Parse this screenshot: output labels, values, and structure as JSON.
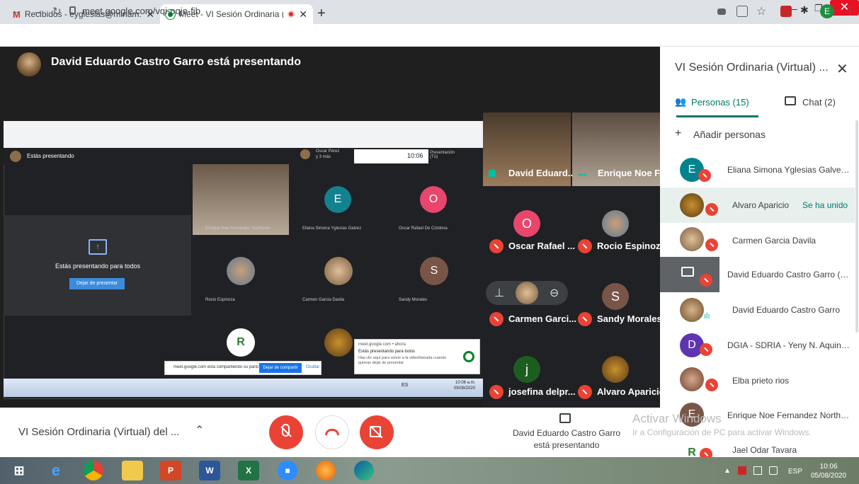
{
  "browser": {
    "tabs": [
      {
        "title": "Recibidos - eyglesias@minam.go",
        "icon": "gmail-icon"
      },
      {
        "title": "Meet - VI Sesión Ordinaria (\\",
        "icon": "meet-icon"
      }
    ],
    "url": "meet.google.com/vqi-pqjo-fib"
  },
  "stage": {
    "presenting_title": "David Eduardo Castro Garro está presentando",
    "shared": {
      "top_label": "Estás presentando",
      "clock": "10:06",
      "presenting_for_all": "Estás presentando para todos",
      "stop_button": "Dejar de presentar",
      "caller_line1": "Oscar Pérez",
      "caller_line2": "y 3 más",
      "present_label": "Presentación (Tú)",
      "share_notice": "meet.google.com está compartiendo su pantalla.",
      "share_stop": "Dejar de compartir",
      "share_hide": "Ocultar",
      "popup_site": "meet.google.com • ahora",
      "popup_title": "Estás presentando para todos",
      "popup_body": "Has clic aquí para volver a la videollamada cuando quieras dejar de presentar",
      "tiles": [
        {
          "name": "Enrique Noe Fernandez Northcote"
        },
        {
          "name": "Eliana Simona Yglesias Galvez",
          "initial": "E"
        },
        {
          "name": "Oscar Rafael De Córdova",
          "initial": "O"
        },
        {
          "name": "Rocio Espinoza"
        },
        {
          "name": "Carmen Garcia Davila"
        },
        {
          "name": "Sandy Morales",
          "initial": "S"
        }
      ],
      "inner_clock_time": "10:06 a.m.",
      "inner_clock_date": "05/08/2020",
      "inner_lang": "ES"
    },
    "tiles": [
      {
        "name": "David Eduard..."
      },
      {
        "name": "Enrique Noe F..."
      },
      {
        "name": "Oscar Rafael ...",
        "initial": "O"
      },
      {
        "name": "Rocio Espinoza"
      },
      {
        "name": "Carmen Garci..."
      },
      {
        "name": "Sandy Morales",
        "initial": "S"
      },
      {
        "name": "josefina delpr...",
        "initial": "j"
      },
      {
        "name": "Alvaro Aparicio"
      }
    ]
  },
  "panel": {
    "title": "VI Sesión Ordinaria (Virtual) ...",
    "tab_people": "Personas (15)",
    "tab_chat": "Chat (2)",
    "add_people": "Añadir personas",
    "people": [
      {
        "name": "Eliana Simona Yglesias Galvez ...",
        "initial": "E",
        "color": "#00838f"
      },
      {
        "name": "Alvaro Aparicio",
        "status": "Se ha unido"
      },
      {
        "name": "Carmen Garcia Davila"
      },
      {
        "name": "David Eduardo Castro Garro (pr..."
      },
      {
        "name": "David Eduardo Castro Garro"
      },
      {
        "name": "DGIA - SDRIA - Yeny N. Aquino ...",
        "initial": "D",
        "color": "#5e35b1"
      },
      {
        "name": "Elba prieto rios"
      },
      {
        "name": "Enrique Noe Fernandez Northc...",
        "initial": "E",
        "color": "#795548"
      },
      {
        "name": "Jael Odar Tavara"
      }
    ]
  },
  "bottom": {
    "meeting_name": "VI Sesión Ordinaria (Virtual) del ...",
    "presenting_line1": "David Eduardo Castro Garro",
    "presenting_line2": "está presentando"
  },
  "watermark": {
    "line1": "Activar Windows",
    "line2": "Ir a Configuración de PC para activar Windows."
  },
  "taskbar": {
    "time": "10:06",
    "date": "05/08/2020",
    "lang": "ESP"
  },
  "colors": {
    "red": "#ea4335",
    "teal": "#00796b",
    "meet_green": "#00832d"
  }
}
